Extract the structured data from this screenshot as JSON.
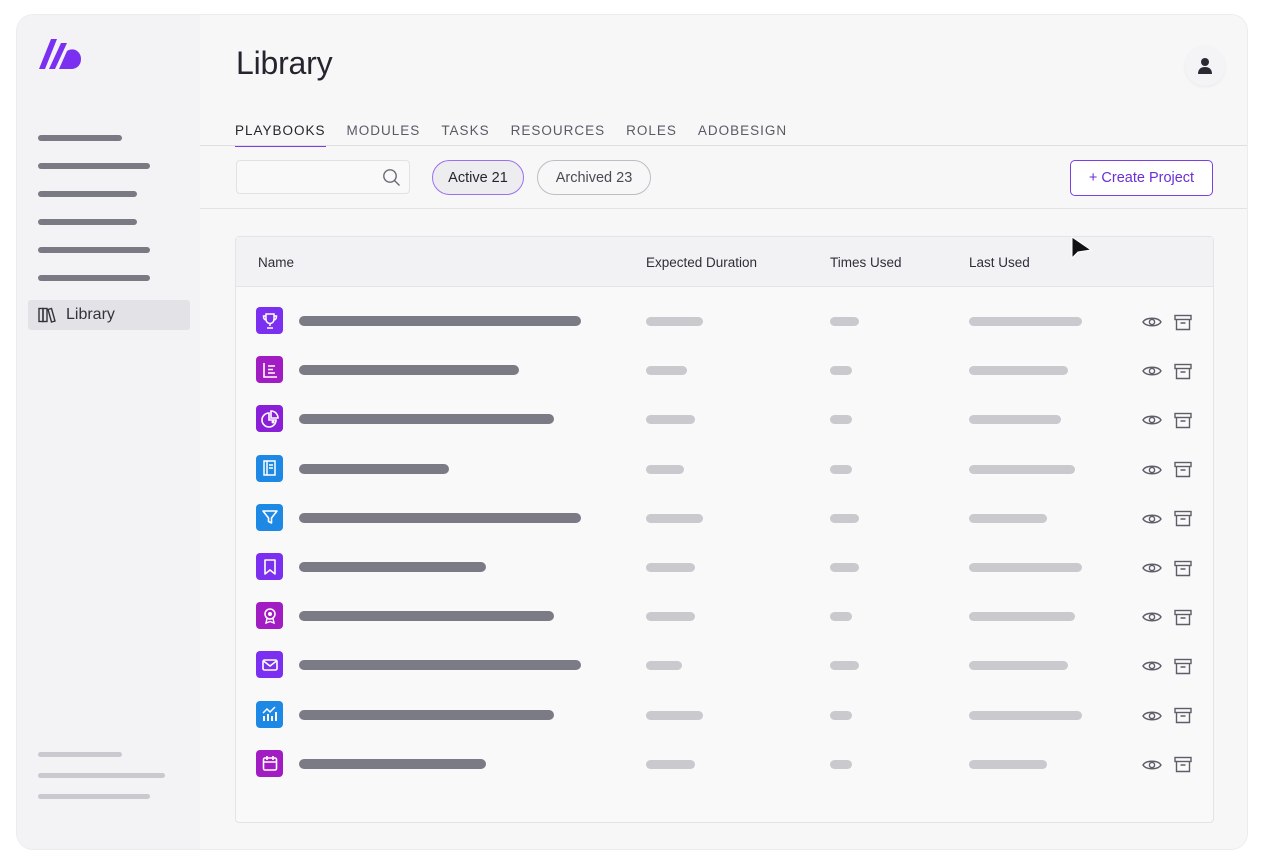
{
  "sidebar": {
    "logo_icon": "brand-logo-icon",
    "library_label": "Library",
    "library_icon": "books-icon"
  },
  "header": {
    "title": "Library",
    "avatar_icon": "user-icon"
  },
  "tabs": [
    {
      "label": "PLAYBOOKS",
      "active": true
    },
    {
      "label": "MODULES",
      "active": false
    },
    {
      "label": "TASKS",
      "active": false
    },
    {
      "label": "RESOURCES",
      "active": false
    },
    {
      "label": "ROLES",
      "active": false
    },
    {
      "label": "ADOBESIGN",
      "active": false
    }
  ],
  "toolbar": {
    "search_value": "",
    "filter_active_label": "Active 21",
    "filter_archived_label": "Archived 23",
    "create_label": "+ Create Project"
  },
  "table": {
    "columns": [
      "Name",
      "Expected Duration",
      "Times Used",
      "Last Used"
    ],
    "rows": [
      {
        "icon": "trophy-icon",
        "color": "#7b2ff0"
      },
      {
        "icon": "list-icon",
        "color": "#a21cc4"
      },
      {
        "icon": "pie-chart-icon",
        "color": "#8a1fd8"
      },
      {
        "icon": "book-icon",
        "color": "#1e88e5"
      },
      {
        "icon": "filter-icon",
        "color": "#1e88e5"
      },
      {
        "icon": "bookmark-icon",
        "color": "#7b2ff0"
      },
      {
        "icon": "award-icon",
        "color": "#a21cc4"
      },
      {
        "icon": "mail-icon",
        "color": "#7b2ff0"
      },
      {
        "icon": "analytics-icon",
        "color": "#1e88e5"
      },
      {
        "icon": "calendar-icon",
        "color": "#a21cc4"
      }
    ],
    "row_actions": [
      "view-icon",
      "archive-icon"
    ]
  },
  "colors": {
    "accent": "#7b3fe4",
    "placeholder_dark": "#7b7b86",
    "placeholder_light": "#c9c9ce"
  }
}
